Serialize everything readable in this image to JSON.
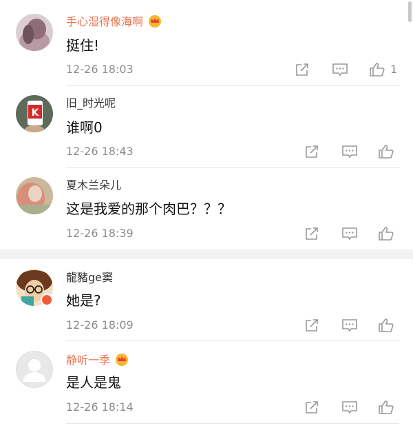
{
  "comments": [
    {
      "user": "手心湿得像海啊",
      "text": "挺住!",
      "time": "12-26 18:03",
      "likes": "1",
      "vip": true
    },
    {
      "user": "旧_时光呢",
      "text": "谁啊0",
      "time": "12-26 18:43",
      "likes": "",
      "vip": false
    },
    {
      "user": "夏木兰朵儿",
      "text": "这是我爱的那个肉巴？？？",
      "time": "12-26 18:39",
      "likes": "",
      "vip": false
    },
    {
      "user": "龍豬ge窦",
      "text": "她是?",
      "time": "12-26 18:09",
      "likes": "",
      "vip": false
    },
    {
      "user": "静听一季",
      "text": "是人是鬼",
      "time": "12-26 18:14",
      "likes": "",
      "vip": true
    }
  ],
  "icons": {
    "share": "share-icon",
    "reply": "comment-icon",
    "like": "thumbs-up-icon",
    "crown": "crown-icon"
  },
  "colors": {
    "vip_name": "#eb7350",
    "name": "#333333",
    "time": "#8a8a8a",
    "badge": "#ef5b3a"
  }
}
